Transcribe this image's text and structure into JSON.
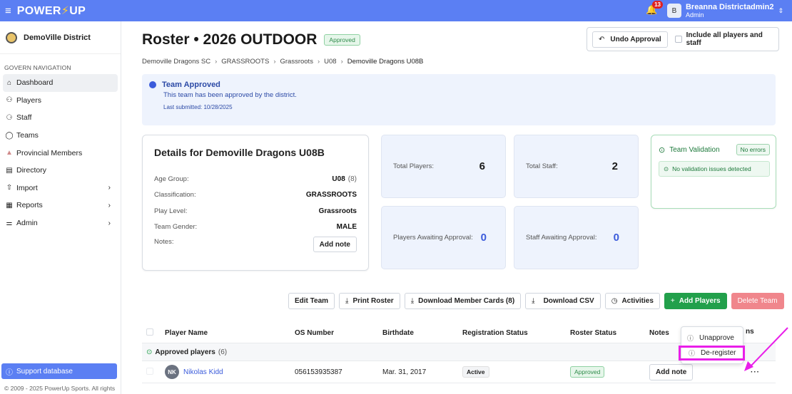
{
  "topbar": {
    "brand_left": "POWER",
    "brand_right": "UP",
    "notification_count": "13",
    "avatar_initial": "B",
    "user_name": "Breanna Districtadmin2",
    "user_role": "Admin"
  },
  "sidebar": {
    "district_name": "DemoVille District",
    "section_heading": "GOVERN NAVIGATION",
    "items": [
      {
        "label": "Dashboard",
        "icon": "home-icon",
        "active": true
      },
      {
        "label": "Players",
        "icon": "users-icon"
      },
      {
        "label": "Staff",
        "icon": "staff-icon"
      },
      {
        "label": "Teams",
        "icon": "shield-icon"
      },
      {
        "label": "Provincial Members",
        "icon": "members-icon"
      },
      {
        "label": "Directory",
        "icon": "directory-icon"
      },
      {
        "label": "Import",
        "icon": "upload-icon",
        "chevron": true
      },
      {
        "label": "Reports",
        "icon": "report-icon",
        "chevron": true
      },
      {
        "label": "Admin",
        "icon": "sliders-icon",
        "chevron": true
      }
    ],
    "support_label": "Support database",
    "copyright": "© 2009 - 2025 PowerUp Sports. All rights"
  },
  "header": {
    "title": "Roster • 2026 OUTDOOR",
    "status_pill": "Approved",
    "undo_label": "Undo Approval",
    "include_label": "Include all players and staff"
  },
  "breadcrumb": [
    "Demoville Dragons SC",
    "GRASSROOTS",
    "Grassroots",
    "U08",
    "Demoville Dragons U08B"
  ],
  "alert": {
    "title": "Team Approved",
    "message": "This team has been approved by the district.",
    "submitted": "Last submitted: 10/28/2025"
  },
  "details": {
    "title": "Details for Demoville Dragons U08B",
    "rows": [
      {
        "label": "Age Group:",
        "value": "U08",
        "sub": "(8)"
      },
      {
        "label": "Classification:",
        "value": "GRASSROOTS"
      },
      {
        "label": "Play Level:",
        "value": "Grassroots"
      },
      {
        "label": "Team Gender:",
        "value": "MALE"
      }
    ],
    "notes_label": "Notes:",
    "add_note_label": "Add note"
  },
  "stats": {
    "total_players_label": "Total Players:",
    "total_players": "6",
    "total_staff_label": "Total Staff:",
    "total_staff": "2",
    "players_awaiting_label": "Players Awaiting Approval:",
    "players_awaiting": "0",
    "staff_awaiting_label": "Staff Awaiting Approval:",
    "staff_awaiting": "0"
  },
  "validation": {
    "title": "Team Validation",
    "badge": "No errors",
    "message": "No validation issues detected"
  },
  "actions": {
    "edit_team": "Edit Team",
    "print_roster": "Print Roster",
    "download_cards": "Download Member Cards (8)",
    "download_csv": "Download CSV",
    "activities": "Activities",
    "add_players": "Add Players",
    "delete_team": "Delete Team"
  },
  "table": {
    "headers": {
      "name": "Player Name",
      "os": "OS Number",
      "birthdate": "Birthdate",
      "registration": "Registration Status",
      "roster": "Roster Status",
      "notes": "Notes",
      "actions_tail": "ns"
    },
    "group_label": "Approved players",
    "group_count": "(6)",
    "rows": [
      {
        "initials": "NK",
        "name": "Nikolas Kidd",
        "os": "056153935387",
        "birthdate": "Mar. 31, 2017",
        "registration": "Active",
        "roster": "Approved",
        "notes_btn": "Add note",
        "actions": "···"
      }
    ]
  },
  "dropdown": {
    "unapprove": "Unapprove",
    "deregister": "De-register"
  },
  "colors": {
    "topbar": "#5b7ff3",
    "accent_green": "#22a04b",
    "delete_red": "#f0868c",
    "highlight_magenta": "#e91ee9"
  }
}
